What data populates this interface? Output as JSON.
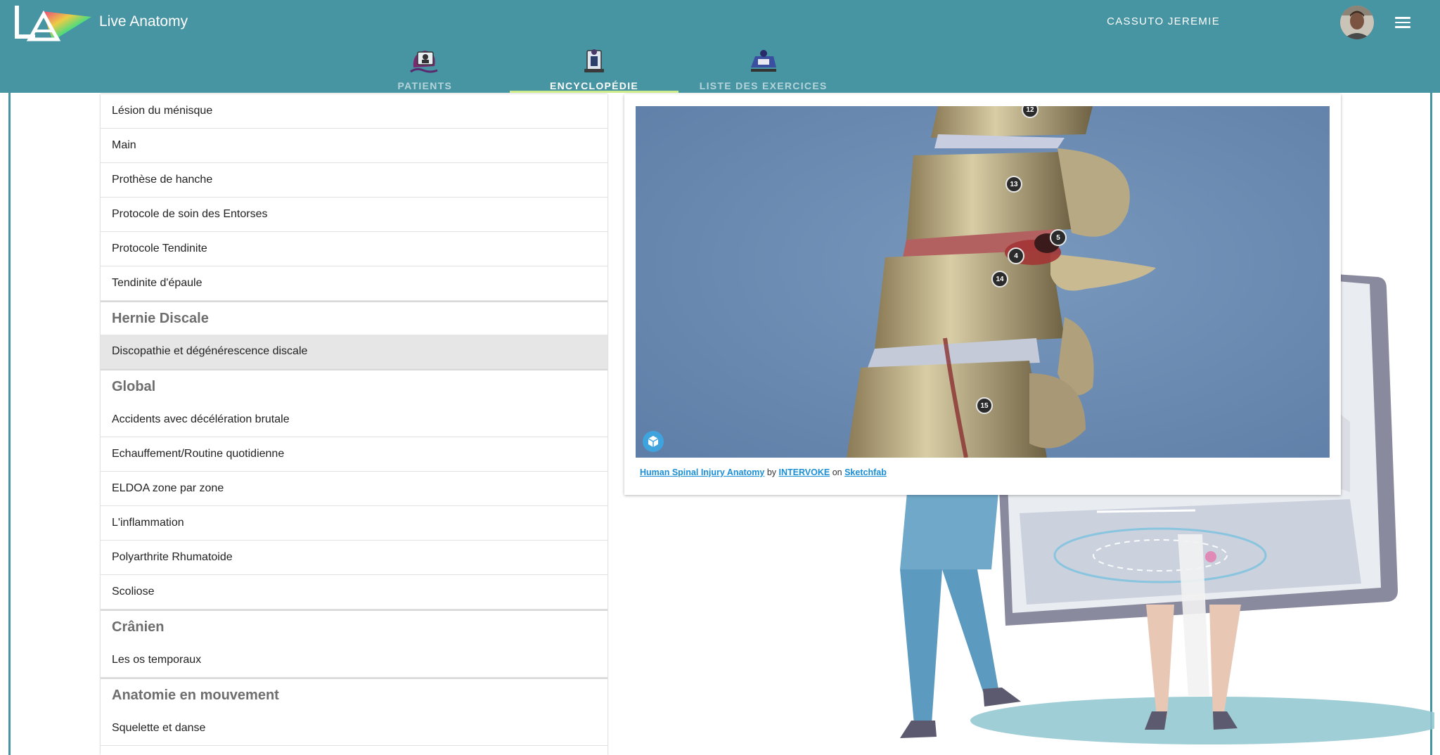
{
  "app": {
    "title": "Live Anatomy"
  },
  "user": {
    "name": "CASSUTO JEREMIE"
  },
  "tabs": [
    {
      "label": "PATIENTS",
      "active": false
    },
    {
      "label": "ENCYCLOPÉDIE",
      "active": true
    },
    {
      "label": "LISTE DES EXERCICES",
      "active": false
    }
  ],
  "list": {
    "items_top": [
      "Lésion du ménisque",
      "Main",
      "Prothèse de hanche",
      "Protocole de soin des Entorses",
      "Protocole Tendinite",
      "Tendinite d'épaule"
    ],
    "sections": [
      {
        "title": "Hernie Discale",
        "items": [
          "Discopathie et dégénérescence discale"
        ]
      },
      {
        "title": "Global",
        "items": [
          "Accidents avec décélération brutale",
          "Echauffement/Routine quotidienne",
          "ELDOA zone par zone",
          "L'inflammation",
          "Polyarthrite Rhumatoide",
          "Scoliose"
        ]
      },
      {
        "title": "Crânien",
        "items": [
          "Les os temporaux"
        ]
      },
      {
        "title": "Anatomie en mouvement",
        "items": [
          "Squelette et danse"
        ]
      }
    ],
    "selected": "Discopathie et dégénérescence discale"
  },
  "model": {
    "hotspots": [
      "12",
      "13",
      "5",
      "4",
      "14",
      "15"
    ],
    "credit": {
      "title": "Human Spinal Injury Anatomy",
      "by": "by",
      "author": "INTERVOKE",
      "on": "on",
      "site": "Sketchfab"
    }
  },
  "colors": {
    "header": "#4794a3",
    "tab_indicator": "#cdeb8b",
    "viewer_bg": "#6f8fb5",
    "link": "#1a8fd6"
  },
  "icons": [
    "logo-la",
    "patients-icon",
    "encyclopedia-icon",
    "exercises-icon",
    "menu-icon",
    "sketchfab-icon"
  ]
}
